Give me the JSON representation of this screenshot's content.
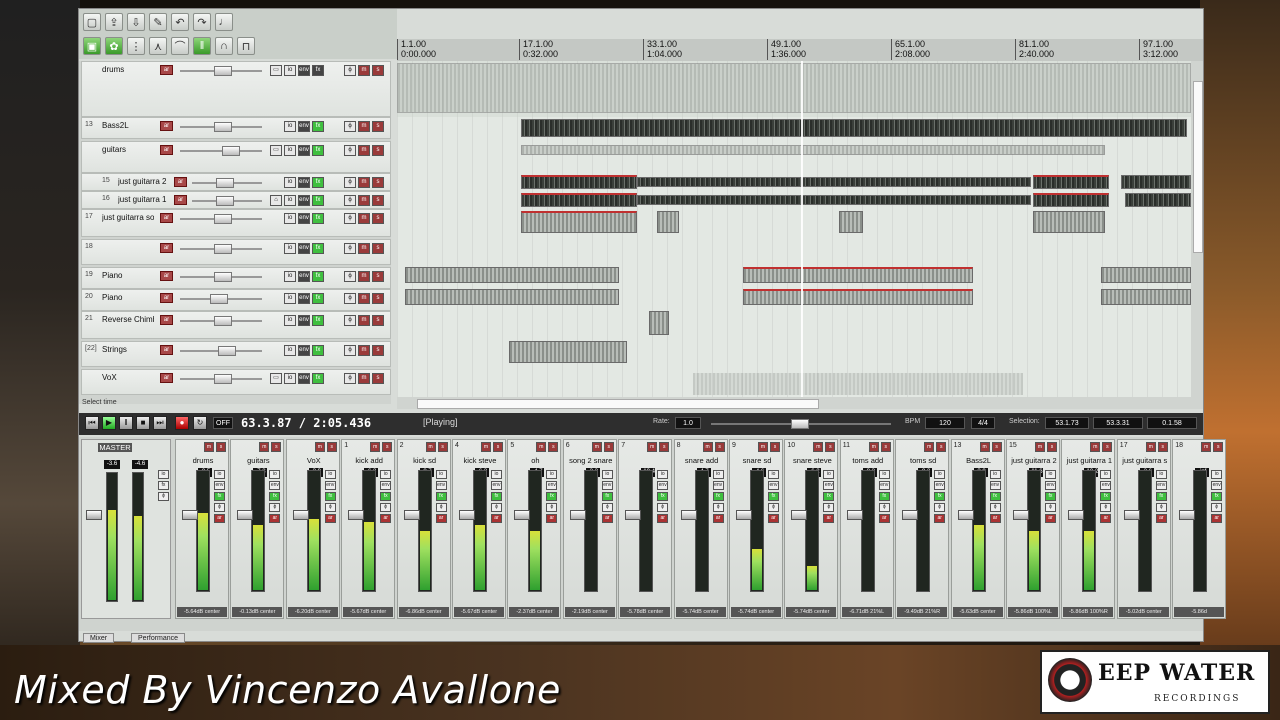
{
  "ruler": {
    "marks": [
      {
        "bar": "1.1.00",
        "time": "0:00.000"
      },
      {
        "bar": "17.1.00",
        "time": "0:32.000"
      },
      {
        "bar": "33.1.00",
        "time": "1:04.000"
      },
      {
        "bar": "49.1.00",
        "time": "1:36.000"
      },
      {
        "bar": "65.1.00",
        "time": "2:08.000"
      },
      {
        "bar": "81.1.00",
        "time": "2:40.000"
      },
      {
        "bar": "97.1.00",
        "time": "3:12.000"
      }
    ]
  },
  "tracks": [
    {
      "num": "",
      "name": "drums"
    },
    {
      "num": "13",
      "name": "Bass2L"
    },
    {
      "num": "",
      "name": "guitars"
    },
    {
      "num": "15",
      "name": "just guitarra 2"
    },
    {
      "num": "16",
      "name": "just guitarra 1"
    },
    {
      "num": "17",
      "name": "just guitarra sol"
    },
    {
      "num": "18",
      "name": ""
    },
    {
      "num": "19",
      "name": "Piano"
    },
    {
      "num": "20",
      "name": "Piano"
    },
    {
      "num": "21",
      "name": "Reverse Chimb"
    },
    {
      "num": "[22]",
      "name": "Strings"
    },
    {
      "num": "",
      "name": "VoX"
    }
  ],
  "status": {
    "text": "Select time"
  },
  "transport": {
    "position": "63.3.87 / 2:05.436",
    "state": "[Playing]",
    "rate_label": "Rate:",
    "rate": "1.0",
    "bpm_label": "BPM",
    "bpm": "120",
    "timesig": "4/4",
    "selection_label": "Selection:",
    "sel_start": "53.1.73",
    "sel_end": "53.3.31",
    "sel_len": "0.1.58",
    "off_label": "OFF"
  },
  "master": {
    "label": "MASTER",
    "peak_l": "-3.6",
    "peak_r": "-4.6"
  },
  "strips": [
    {
      "num": "",
      "name": "drums",
      "peak": "-0.5",
      "readout": "-5.64dB center",
      "level": 0.65
    },
    {
      "num": "",
      "name": "guitars",
      "peak": "-7.3",
      "readout": "-0.13dB center",
      "level": 0.55
    },
    {
      "num": "",
      "name": "VoX",
      "peak": "-3.9",
      "readout": "-6.20dB center",
      "level": 0.6
    },
    {
      "num": "1",
      "name": "kick add",
      "peak": "-6.3",
      "readout": "-5.67dB center",
      "level": 0.58
    },
    {
      "num": "2",
      "name": "kick sd",
      "peak": "-8.7",
      "readout": "-6.86dB center",
      "level": 0.5
    },
    {
      "num": "4",
      "name": "kick steve",
      "peak": "-6.3",
      "readout": "-5.67dB center",
      "level": 0.55
    },
    {
      "num": "5",
      "name": "oh",
      "peak": "-4.7",
      "readout": "-2.37dB center",
      "level": 0.5
    },
    {
      "num": "6",
      "name": "song 2 snare",
      "peak": "-2.2",
      "readout": "-2.19dB center",
      "level": 0.0
    },
    {
      "num": "7",
      "name": "",
      "peak": "-10.4",
      "readout": "-5.78dB center",
      "level": 0.0
    },
    {
      "num": "8",
      "name": "snare add",
      "peak": "-4.7",
      "readout": "-5.74dB center",
      "level": 0.0
    },
    {
      "num": "9",
      "name": "snare sd",
      "peak": "-4.6",
      "readout": "-5.74dB center",
      "level": 0.35
    },
    {
      "num": "10",
      "name": "snare steve",
      "peak": "-6.2",
      "readout": "-5.74dB center",
      "level": 0.2
    },
    {
      "num": "11",
      "name": "toms add",
      "peak": "-8.3",
      "readout": "-6.71dB 21%L",
      "level": 0.0
    },
    {
      "num": "",
      "name": "toms sd",
      "peak": "-9.3",
      "readout": "-9.49dB 21%R",
      "level": 0.0
    },
    {
      "num": "13",
      "name": "Bass2L",
      "peak": "-3.9",
      "readout": "-5.63dB center",
      "level": 0.55
    },
    {
      "num": "15",
      "name": "just guitarra 2",
      "peak": "-11.6",
      "readout": "-5.86dB 100%L",
      "level": 0.5
    },
    {
      "num": "",
      "name": "just guitarra 1",
      "peak": "-10.2",
      "readout": "-5.86dB 100%R",
      "level": 0.5
    },
    {
      "num": "17",
      "name": "just guitarra s",
      "peak": "-2.6",
      "readout": "-5.02dB center",
      "level": 0.0
    },
    {
      "num": "18",
      "name": "",
      "peak": "-inf",
      "readout": "-5.86d",
      "level": 0.0
    }
  ],
  "mixer_tabs": [
    "Mixer",
    "Performance"
  ],
  "caption": "Mixed By Vincenzo Avallone",
  "logo": {
    "title": "EEP WATER",
    "sub": "RECORDINGS"
  },
  "colors": {
    "meter_green": "#3fbf3f",
    "arm_red": "#a84848",
    "transport_bg": "#2e2e2e"
  }
}
